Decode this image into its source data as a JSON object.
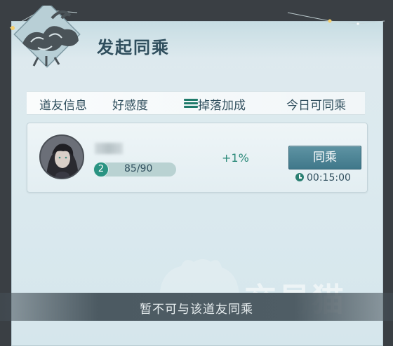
{
  "dialog": {
    "title": "发起同乘"
  },
  "columns": {
    "friend_info": "道友信息",
    "favorability": "好感度",
    "drop_bonus": "掉落加成",
    "today_ride": "今日可同乘"
  },
  "friend": {
    "level": "2",
    "favor": "85/90",
    "favor_progress": 0.944,
    "drop_bonus": "+1%",
    "ride_button": "同乘",
    "timer": "00:15:00"
  },
  "footer": {
    "message": "暂不可与该道友同乘"
  },
  "watermark": {
    "text": "交易猫"
  },
  "colors": {
    "accent": "#2a9382",
    "button": "#4f8799",
    "title": "#2f4e5d"
  }
}
